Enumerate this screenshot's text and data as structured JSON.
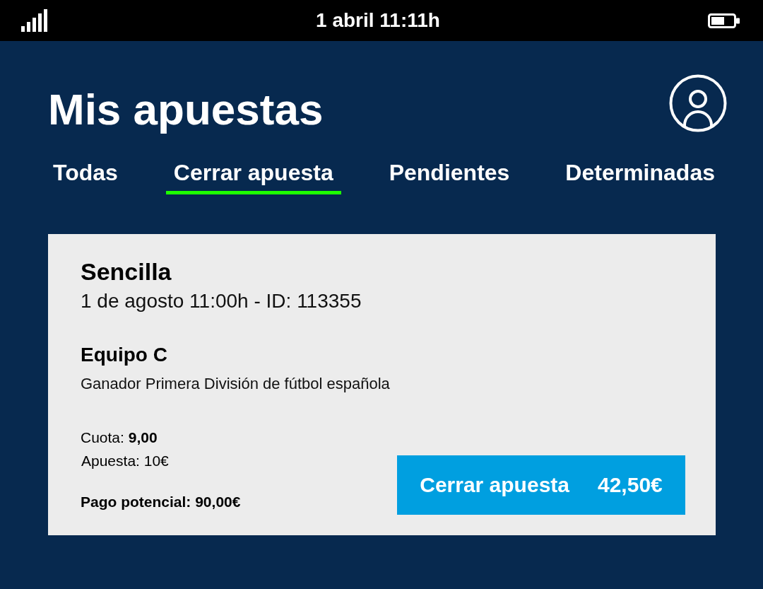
{
  "status_bar": {
    "time": "1 abril 11:11h"
  },
  "header": {
    "title": "Mis apuestas"
  },
  "tabs": [
    {
      "label": "Todas",
      "selected": false
    },
    {
      "label": "Cerrar apuesta",
      "selected": true
    },
    {
      "label": "Pendientes",
      "selected": false
    },
    {
      "label": "Determinadas",
      "selected": false
    }
  ],
  "bet": {
    "type": "Sencilla",
    "datetime": "1 de agosto 11:00h - ID: 113355",
    "selection": "Equipo C",
    "market": "Ganador Primera División de fútbol española",
    "odds": "Cuota: **9,00**",
    "stake": "Apuesta: 10€",
    "potential_payout": "Pago potencial: 90,00€",
    "cashout_button": {
      "label": "Cerrar apuesta",
      "amount": "42,50€"
    }
  }
}
